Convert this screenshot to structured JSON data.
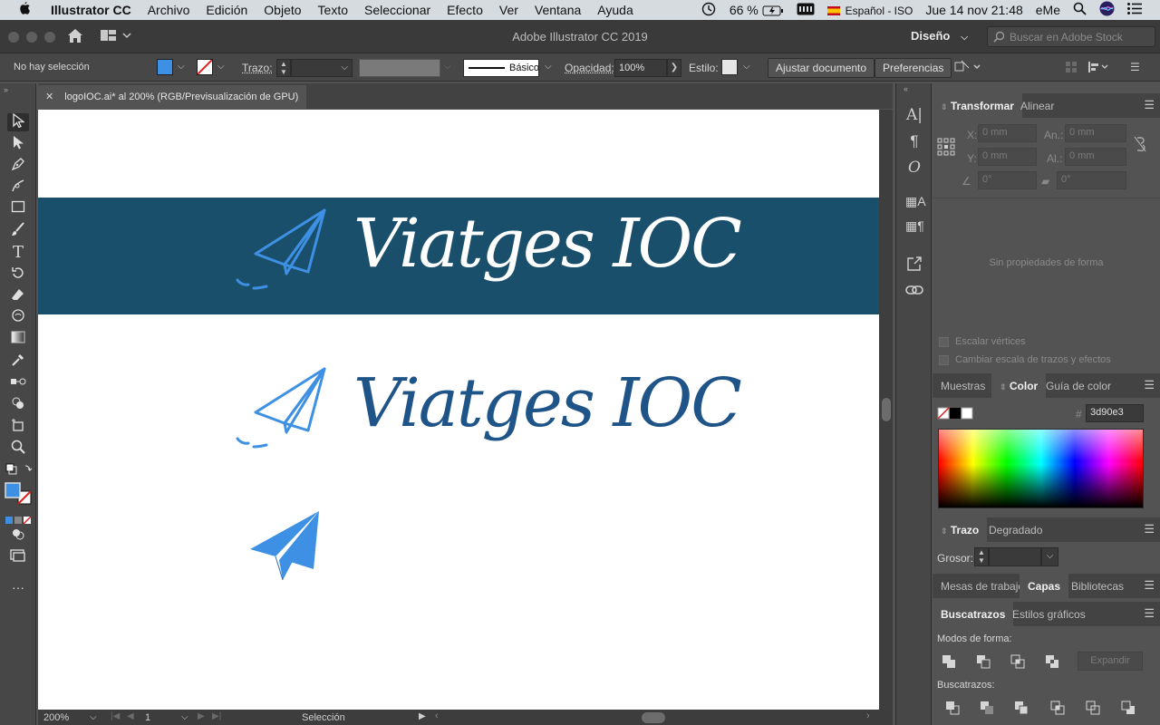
{
  "menubar": {
    "apple": "",
    "app_name": "Illustrator CC",
    "items": [
      "Archivo",
      "Edición",
      "Objeto",
      "Texto",
      "Seleccionar",
      "Efecto",
      "Ver",
      "Ventana",
      "Ayuda"
    ],
    "battery": "66 %",
    "input_source": "Español - ISO",
    "datetime": "Jue 14 nov  21:48",
    "user": "eMe"
  },
  "titlebar": {
    "title": "Adobe Illustrator CC 2019",
    "workspace": "Diseño",
    "stock_search_placeholder": "Buscar en Adobe Stock"
  },
  "controlbar": {
    "selection_status": "No hay selección",
    "fill_color": "#3d90e3",
    "stroke_label": "Trazo:",
    "brush_label": "Básico",
    "opacity_label": "Opacidad:",
    "opacity_value": "100%",
    "style_label": "Estilo:",
    "adjust_button": "Ajustar documento",
    "prefs_button": "Preferencias"
  },
  "document": {
    "tab_label": "logoIOC.ai* al 200% (RGB/Previsualización de GPU)",
    "logo_text": "Viatges IOC",
    "banner_color": "#1a4f6c",
    "light_blue": "#3d90e3",
    "dark_blue": "#1e5488"
  },
  "statusbar": {
    "zoom": "200%",
    "artboard": "1",
    "tool": "Selección"
  },
  "panels": {
    "transform": {
      "tabs": [
        "Transformar",
        "Alinear"
      ],
      "x_label": "X:",
      "y_label": "Y:",
      "w_label": "An.:",
      "h_label": "Al.:",
      "x_value": "0 mm",
      "y_value": "0 mm",
      "w_value": "0 mm",
      "h_value": "0 mm",
      "angle_value": "0°",
      "shear_value": "0°",
      "empty_message": "Sin propiedades de forma",
      "scale_corners": "Escalar vértices",
      "scale_strokes": "Cambiar escala de trazos y efectos"
    },
    "color": {
      "tabs": [
        "Muestras",
        "Color",
        "Guía de color"
      ],
      "hash": "#",
      "hex_value": "3d90e3"
    },
    "stroke": {
      "tabs": [
        "Trazo",
        "Degradado"
      ],
      "weight_label": "Grosor:"
    },
    "layers": {
      "tabs": [
        "Mesas de trabajo",
        "Capas",
        "Bibliotecas"
      ]
    },
    "pathfinder": {
      "tabs": [
        "Buscatrazos",
        "Estilos gráficos"
      ],
      "shape_modes_label": "Modos de forma:",
      "expand_button": "Expandir",
      "pathfinders_label": "Buscatrazos:"
    }
  }
}
